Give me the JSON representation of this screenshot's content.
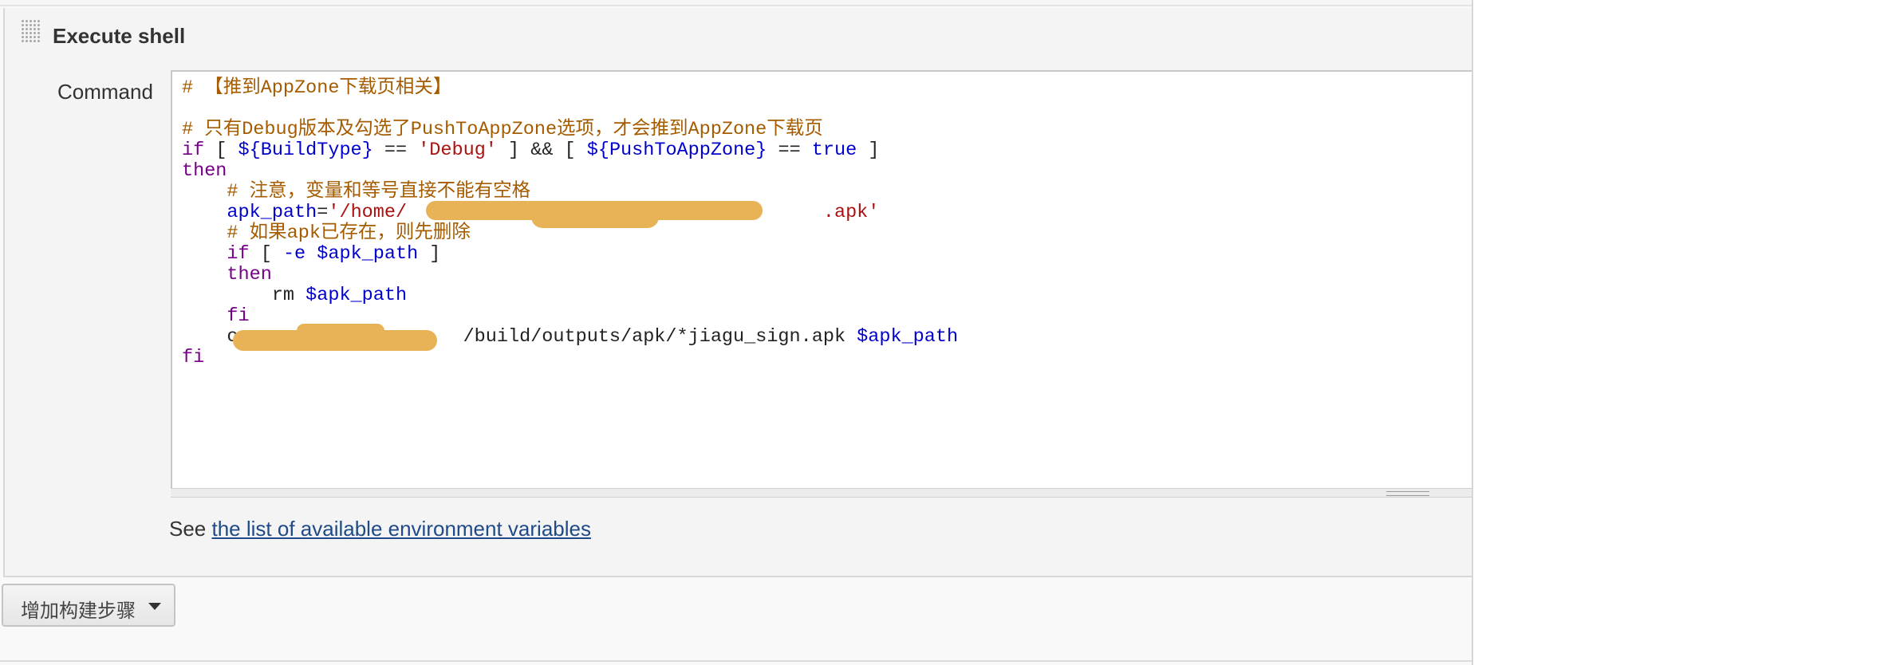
{
  "step": {
    "title": "Execute shell",
    "command_label": "Command"
  },
  "code_lines": [
    [
      {
        "t": "comment",
        "v": "# 【推到AppZone下载页相关】"
      }
    ],
    [],
    [
      {
        "t": "comment",
        "v": "# 只有Debug版本及勾选了PushToAppZone选项，才会推到AppZone下载页"
      }
    ],
    [
      {
        "t": "kw",
        "v": "if"
      },
      {
        "t": "plain",
        "v": " [ "
      },
      {
        "t": "var",
        "v": "${BuildType}"
      },
      {
        "t": "plain",
        "v": " == "
      },
      {
        "t": "str",
        "v": "'Debug'"
      },
      {
        "t": "plain",
        "v": " ] && [ "
      },
      {
        "t": "var",
        "v": "${PushToAppZone}"
      },
      {
        "t": "plain",
        "v": " == "
      },
      {
        "t": "var",
        "v": "true"
      },
      {
        "t": "plain",
        "v": " ]"
      }
    ],
    [
      {
        "t": "kw",
        "v": "then"
      }
    ],
    [
      {
        "t": "plain",
        "v": "    "
      },
      {
        "t": "comment",
        "v": "# 注意，变量和等号直接不能有空格"
      }
    ],
    [
      {
        "t": "plain",
        "v": "    "
      },
      {
        "t": "var",
        "v": "apk_path"
      },
      {
        "t": "plain",
        "v": "="
      },
      {
        "t": "str",
        "v": "'/home/"
      },
      {
        "t": "plain",
        "v": "                                     "
      },
      {
        "t": "str",
        "v": ".apk'"
      }
    ],
    [
      {
        "t": "plain",
        "v": "    "
      },
      {
        "t": "comment",
        "v": "# 如果apk已存在，则先删除"
      }
    ],
    [
      {
        "t": "plain",
        "v": "    "
      },
      {
        "t": "kw",
        "v": "if"
      },
      {
        "t": "plain",
        "v": " [ "
      },
      {
        "t": "var",
        "v": "-e"
      },
      {
        "t": "plain",
        "v": " "
      },
      {
        "t": "var",
        "v": "$apk_path"
      },
      {
        "t": "plain",
        "v": " ]"
      }
    ],
    [
      {
        "t": "plain",
        "v": "    "
      },
      {
        "t": "kw",
        "v": "then"
      }
    ],
    [
      {
        "t": "plain",
        "v": "        rm "
      },
      {
        "t": "var",
        "v": "$apk_path"
      }
    ],
    [
      {
        "t": "plain",
        "v": "    "
      },
      {
        "t": "kw",
        "v": "fi"
      }
    ],
    [
      {
        "t": "plain",
        "v": "    cp "
      },
      {
        "t": "plain",
        "v": "                  "
      },
      {
        "t": "plain",
        "v": "/build/outputs/apk/*jiagu_sign.apk "
      },
      {
        "t": "var",
        "v": "$apk_path"
      }
    ],
    [
      {
        "t": "kw",
        "v": "fi"
      }
    ]
  ],
  "help": {
    "prefix": "See",
    "link_text": "the list of available environment variables"
  },
  "add_step_button": {
    "label": "增加构建步骤"
  },
  "colors": {
    "comment": "#a55c00",
    "keyword": "#770088",
    "variable": "#0000cc",
    "string": "#aa1111",
    "link": "#204a87",
    "redaction": "#e8b257"
  }
}
